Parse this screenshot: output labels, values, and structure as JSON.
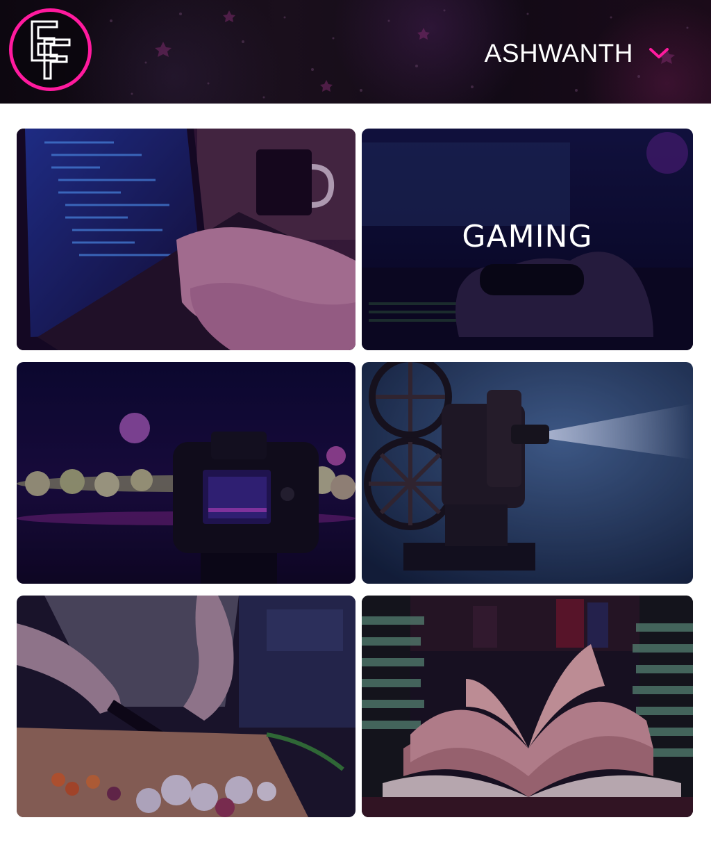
{
  "header": {
    "logo_text": "EF",
    "user_name": "ASHWANTH",
    "menu_icon": "chevron-down-icon",
    "accent_color": "#ff1a9e"
  },
  "categories": [
    {
      "id": "coding",
      "title": ""
    },
    {
      "id": "gaming",
      "title": "GAMING"
    },
    {
      "id": "photography",
      "title": ""
    },
    {
      "id": "movies",
      "title": ""
    },
    {
      "id": "cooking",
      "title": ""
    },
    {
      "id": "reading",
      "title": ""
    }
  ]
}
